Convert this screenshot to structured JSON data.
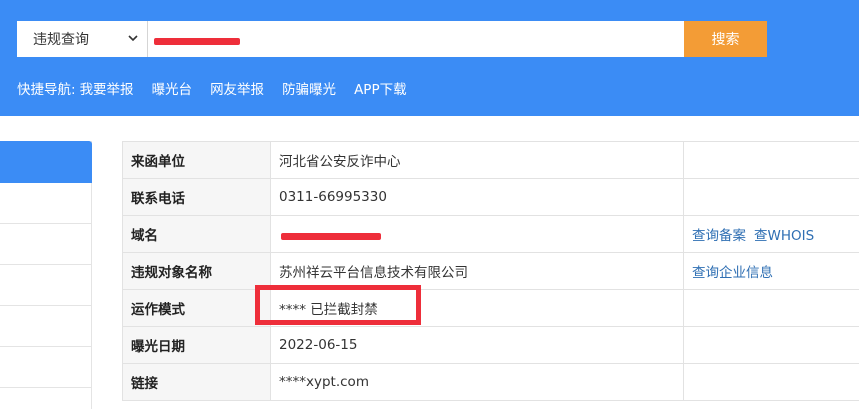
{
  "search": {
    "category": "违规查询",
    "query_value": "",
    "button_label": "搜索"
  },
  "quicknav": {
    "label": "快捷导航:",
    "links": [
      "我要举报",
      "曝光台",
      "网友举报",
      "防骗曝光",
      "APP下载"
    ]
  },
  "details": {
    "rows": [
      {
        "key": "来函单位",
        "value": "河北省公安反诈中心",
        "actions": []
      },
      {
        "key": "联系电话",
        "value": "0311-66995330",
        "actions": []
      },
      {
        "key": "域名",
        "value": "",
        "actions": [
          "查询备案",
          "查WHOIS"
        ]
      },
      {
        "key": "违规对象名称",
        "value": "苏州祥云平台信息技术有限公司",
        "actions": [
          "查询企业信息"
        ]
      },
      {
        "key": "运作模式",
        "value": "**** 已拦截封禁",
        "actions": []
      },
      {
        "key": "曝光日期",
        "value": "2022-06-15",
        "actions": []
      },
      {
        "key": "链接",
        "value": "****xypt.com",
        "actions": []
      }
    ]
  },
  "colors": {
    "header_bg": "#3b8cf5",
    "search_button": "#f39c36",
    "redaction": "#ee2e3a",
    "link": "#2f6fb3"
  }
}
